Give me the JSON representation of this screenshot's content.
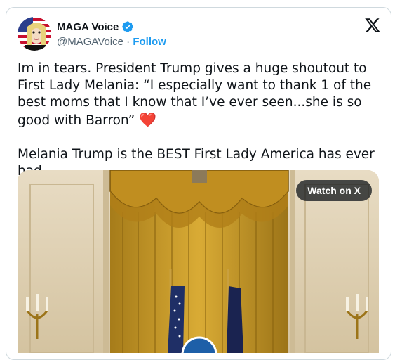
{
  "author": {
    "display_name": "MAGA Voice",
    "handle": "@MAGAVoice",
    "separator": "·",
    "follow_label": "Follow"
  },
  "tweet": {
    "paragraph1": "Im in tears. President Trump gives a huge shoutout to First Lady Melania: “I especially want to thank 1 of the best moms that I know that I’ve ever seen...she is so good with Barron”",
    "emoji": "❤️",
    "paragraph2": "Melania Trump is the BEST First Lady America has ever had"
  },
  "media": {
    "watch_label": "Watch on X"
  },
  "icons": {
    "brand": "x-logo-icon",
    "verified": "verified-badge-icon"
  },
  "colors": {
    "accent": "#1d9bf0",
    "text": "#0f1419",
    "muted": "#536471",
    "heart": "#e0245e"
  }
}
